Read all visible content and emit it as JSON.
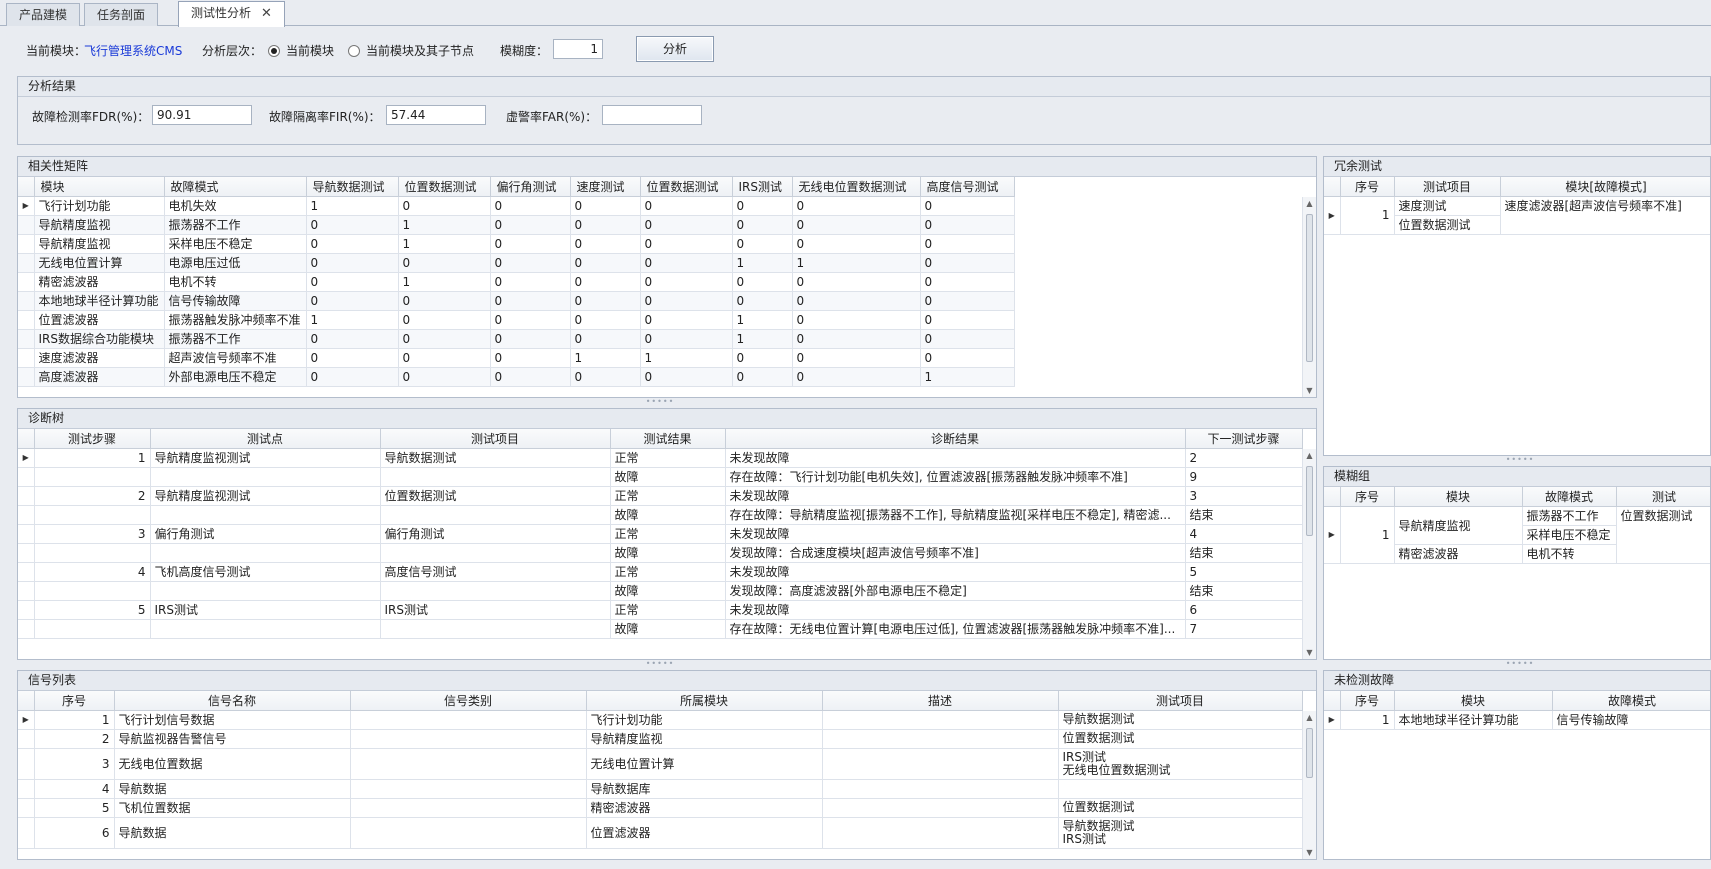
{
  "tabs": [
    {
      "label": "产品建模"
    },
    {
      "label": "任务剖面"
    },
    {
      "label": "测试性分析"
    }
  ],
  "toolbar": {
    "module_label": "当前模块：",
    "module_value": "飞行管理系统CMS",
    "level_label": "分析层次：",
    "radio_current": "当前模块",
    "radio_children": "当前模块及其子节点",
    "fuzzy_label": "模糊度：",
    "fuzzy_value": "1",
    "analyze_button": "分析"
  },
  "results": {
    "title": "分析结果",
    "fdr_label": "故障检测率FDR(%)：",
    "fdr_value": "90.91",
    "fir_label": "故障隔离率FIR(%)：",
    "fir_value": "57.44",
    "far_label": "虚警率FAR(%)：",
    "far_value": ""
  },
  "matrix": {
    "title": "相关性矩阵",
    "columns": [
      "模块",
      "故障模式",
      "导航数据测试",
      "位置数据测试",
      "偏行角测试",
      "速度测试",
      "位置数据测试",
      "IRS测试",
      "无线电位置数据测试",
      "高度信号测试"
    ],
    "rows": [
      [
        "飞行计划功能",
        "电机失效",
        "1",
        "0",
        "0",
        "0",
        "0",
        "0",
        "0",
        "0"
      ],
      [
        "导航精度监视",
        "振荡器不工作",
        "0",
        "1",
        "0",
        "0",
        "0",
        "0",
        "0",
        "0"
      ],
      [
        "导航精度监视",
        "采样电压不稳定",
        "0",
        "1",
        "0",
        "0",
        "0",
        "0",
        "0",
        "0"
      ],
      [
        "无线电位置计算",
        "电源电压过低",
        "0",
        "0",
        "0",
        "0",
        "0",
        "1",
        "1",
        "0"
      ],
      [
        "精密滤波器",
        "电机不转",
        "0",
        "1",
        "0",
        "0",
        "0",
        "0",
        "0",
        "0"
      ],
      [
        "本地地球半径计算功能",
        "信号传输故障",
        "0",
        "0",
        "0",
        "0",
        "0",
        "0",
        "0",
        "0"
      ],
      [
        "位置滤波器",
        "振荡器触发脉冲频率不准",
        "1",
        "0",
        "0",
        "0",
        "0",
        "1",
        "0",
        "0"
      ],
      [
        "IRS数据综合功能模块",
        "振荡器不工作",
        "0",
        "0",
        "0",
        "0",
        "0",
        "1",
        "0",
        "0"
      ],
      [
        "速度滤波器",
        "超声波信号频率不准",
        "0",
        "0",
        "0",
        "1",
        "1",
        "0",
        "0",
        "0"
      ],
      [
        "高度滤波器",
        "外部电源电压不稳定",
        "0",
        "0",
        "0",
        "0",
        "0",
        "0",
        "0",
        "1"
      ]
    ]
  },
  "redundant": {
    "title": "冗余测试",
    "columns": [
      "序号",
      "测试项目",
      "模块[故障模式]"
    ],
    "index": "1",
    "items": [
      "速度测试",
      "位置数据测试"
    ],
    "module_fault": "速度滤波器[超声波信号频率不准]"
  },
  "diagnosis": {
    "title": "诊断树",
    "columns": [
      "测试步骤",
      "测试点",
      "测试项目",
      "测试结果",
      "诊断结果",
      "下一测试步骤"
    ],
    "rows": [
      [
        "1",
        "导航精度监视测试",
        "导航数据测试",
        "正常",
        "未发现故障",
        "2"
      ],
      [
        "",
        "",
        "",
        "故障",
        "存在故障：飞行计划功能[电机失效], 位置滤波器[振荡器触发脉冲频率不准]",
        "9"
      ],
      [
        "2",
        "导航精度监视测试",
        "位置数据测试",
        "正常",
        "未发现故障",
        "3"
      ],
      [
        "",
        "",
        "",
        "故障",
        "存在故障：导航精度监视[振荡器不工作], 导航精度监视[采样电压不稳定], 精密滤...",
        "结束"
      ],
      [
        "3",
        "偏行角测试",
        "偏行角测试",
        "正常",
        "未发现故障",
        "4"
      ],
      [
        "",
        "",
        "",
        "故障",
        "发现故障：合成速度模块[超声波信号频率不准]",
        "结束"
      ],
      [
        "4",
        "飞机高度信号测试",
        "高度信号测试",
        "正常",
        "未发现故障",
        "5"
      ],
      [
        "",
        "",
        "",
        "故障",
        "发现故障：高度滤波器[外部电源电压不稳定]",
        "结束"
      ],
      [
        "5",
        "IRS测试",
        "IRS测试",
        "正常",
        "未发现故障",
        "6"
      ],
      [
        "",
        "",
        "",
        "故障",
        "存在故障：无线电位置计算[电源电压过低], 位置滤波器[振荡器触发脉冲频率不准]...",
        "7"
      ]
    ]
  },
  "fuzzy": {
    "title": "模糊组",
    "columns": [
      "序号",
      "模块",
      "故障模式",
      "测试"
    ],
    "index": "1",
    "module_a": "导航精度监视",
    "fault_a1": "振荡器不工作",
    "fault_a2": "采样电压不稳定",
    "module_b": "精密滤波器",
    "fault_b": "电机不转",
    "test": "位置数据测试"
  },
  "signals": {
    "title": "信号列表",
    "columns": [
      "序号",
      "信号名称",
      "信号类别",
      "所属模块",
      "描述",
      "测试项目"
    ],
    "rows": [
      {
        "no": "1",
        "name": "飞行计划信号数据",
        "cat": "",
        "module": "飞行计划功能",
        "desc": "",
        "tests": [
          "导航数据测试"
        ]
      },
      {
        "no": "2",
        "name": "导航监视器告警信号",
        "cat": "",
        "module": "导航精度监视",
        "desc": "",
        "tests": [
          "位置数据测试"
        ]
      },
      {
        "no": "3",
        "name": "无线电位置数据",
        "cat": "",
        "module": "无线电位置计算",
        "desc": "",
        "tests": [
          "IRS测试",
          "无线电位置数据测试"
        ]
      },
      {
        "no": "4",
        "name": "导航数据",
        "cat": "",
        "module": "导航数据库",
        "desc": "",
        "tests": [
          ""
        ]
      },
      {
        "no": "5",
        "name": "飞机位置数据",
        "cat": "",
        "module": "精密滤波器",
        "desc": "",
        "tests": [
          "位置数据测试"
        ]
      },
      {
        "no": "6",
        "name": "导航数据",
        "cat": "",
        "module": "位置滤波器",
        "desc": "",
        "tests": [
          "导航数据测试",
          "IRS测试"
        ]
      }
    ]
  },
  "undetected": {
    "title": "未检测故障",
    "columns": [
      "序号",
      "模块",
      "故障模式"
    ],
    "rows": [
      [
        "1",
        "本地地球半径计算功能",
        "信号传输故障"
      ]
    ]
  }
}
